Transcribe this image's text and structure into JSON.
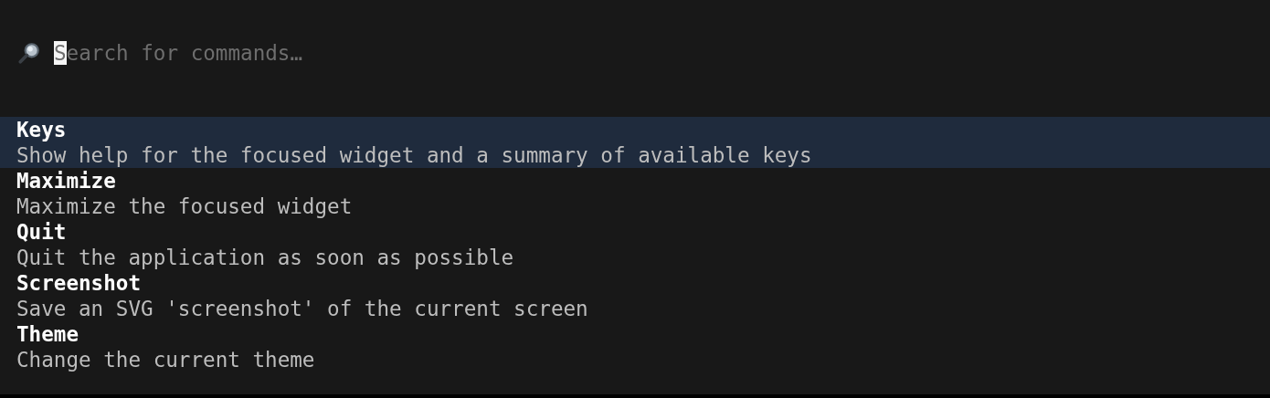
{
  "search": {
    "placeholder": "Search for commands…",
    "focused": true
  },
  "commands": [
    {
      "title": "Keys",
      "help": "Show help for the focused widget and a summary of available keys",
      "selected": true
    },
    {
      "title": "Maximize",
      "help": "Maximize the focused widget",
      "selected": false
    },
    {
      "title": "Quit",
      "help": "Quit the application as soon as possible",
      "selected": false
    },
    {
      "title": "Screenshot",
      "help": "Save an SVG 'screenshot' of the current screen",
      "selected": false
    },
    {
      "title": "Theme",
      "help": "Change the current theme",
      "selected": false
    }
  ]
}
